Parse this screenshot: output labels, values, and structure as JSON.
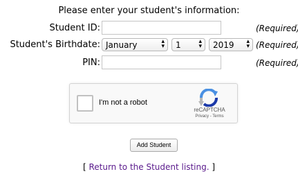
{
  "form": {
    "title": "Please enter your student's information:",
    "student_id": {
      "label": "Student ID:",
      "value": "",
      "required": "(Required)"
    },
    "birthdate": {
      "label": "Student's Birthdate:",
      "month": "January",
      "day": "1",
      "year": "2019",
      "required": "(Required)"
    },
    "pin": {
      "label": "PIN:",
      "value": "",
      "required": "(Required)"
    }
  },
  "recaptcha": {
    "checkbox_label": "I'm not a robot",
    "brand": "reCAPTCHA",
    "links": "Privacy - Terms",
    "icon": "recaptcha-logo-icon",
    "colors": {
      "blue": "#4a90e2",
      "dark_blue": "#1c3aa9",
      "gray": "#b6b6b6"
    }
  },
  "add_button": "Add Student",
  "footer": {
    "open_bracket": "[",
    "link_text": "Return to the Student listing.",
    "close_bracket": "]",
    "link_color": "#5a1a8c"
  }
}
